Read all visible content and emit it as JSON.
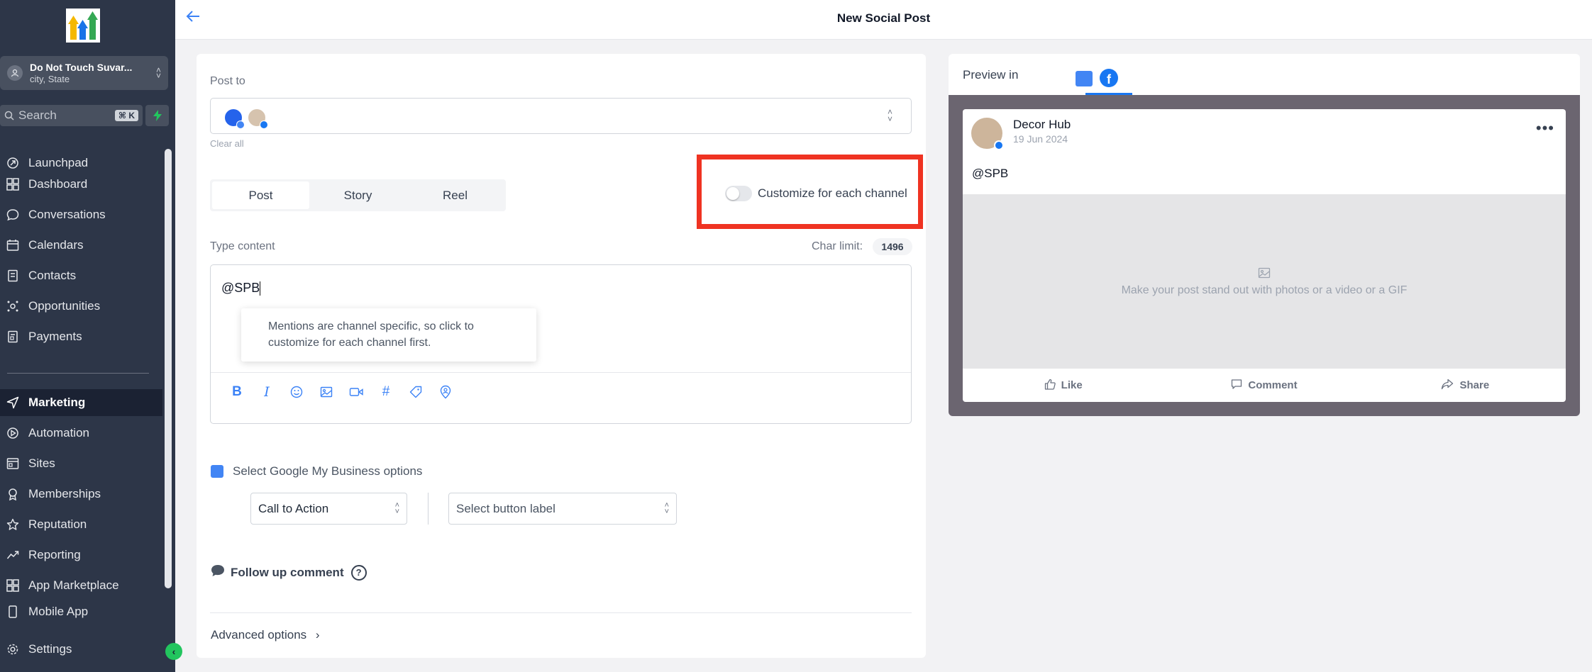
{
  "header": {
    "title": "New Social Post"
  },
  "sidebar": {
    "account": {
      "name": "Do Not Touch Suvar...",
      "location": "city, State"
    },
    "search": {
      "placeholder": "Search",
      "shortcut": "⌘ K"
    },
    "items": [
      {
        "label": "Launchpad",
        "icon": "rocket-icon"
      },
      {
        "label": "Dashboard",
        "icon": "dashboard-icon"
      },
      {
        "label": "Conversations",
        "icon": "chat-icon"
      },
      {
        "label": "Calendars",
        "icon": "calendar-icon"
      },
      {
        "label": "Contacts",
        "icon": "contacts-icon"
      },
      {
        "label": "Opportunities",
        "icon": "opportunities-icon"
      },
      {
        "label": "Payments",
        "icon": "payments-icon"
      },
      {
        "label": "Marketing",
        "icon": "send-icon",
        "active": true
      },
      {
        "label": "Automation",
        "icon": "automation-icon"
      },
      {
        "label": "Sites",
        "icon": "sites-icon"
      },
      {
        "label": "Memberships",
        "icon": "memberships-icon"
      },
      {
        "label": "Reputation",
        "icon": "star-icon"
      },
      {
        "label": "Reporting",
        "icon": "reporting-icon"
      },
      {
        "label": "App Marketplace",
        "icon": "apps-icon"
      },
      {
        "label": "Mobile App",
        "icon": "mobile-icon"
      },
      {
        "label": "Settings",
        "icon": "gear-icon"
      }
    ]
  },
  "composer": {
    "post_to_label": "Post to",
    "clear_all": "Clear all",
    "tabs": [
      "Post",
      "Story",
      "Reel"
    ],
    "selected_tab": "Post",
    "customize_label": "Customize for each channel",
    "customize_enabled": false,
    "content_label": "Type content",
    "char_limit_label": "Char limit:",
    "char_limit_value": "1496",
    "content_value": "@SPB",
    "tooltip": "Mentions are channel specific, so click to customize for each channel first.",
    "gmb_label": "Select Google My Business options",
    "cta_select": "Call to Action",
    "button_label_select": "Select button label",
    "follow_up_label": "Follow up comment",
    "help_glyph": "?",
    "advanced_label": "Advanced options"
  },
  "preview": {
    "label": "Preview in",
    "active_tab": "facebook",
    "page_name": "Decor Hub",
    "date": "19 Jun 2024",
    "post_text": "@SPB",
    "media_placeholder": "Make your post stand out with photos or a video or a GIF",
    "actions": [
      "Like",
      "Comment",
      "Share"
    ]
  },
  "colors": {
    "accent": "#3b82f6",
    "facebook": "#1877f2",
    "highlight": "#ef3322",
    "sidebar": "#2d3648"
  }
}
